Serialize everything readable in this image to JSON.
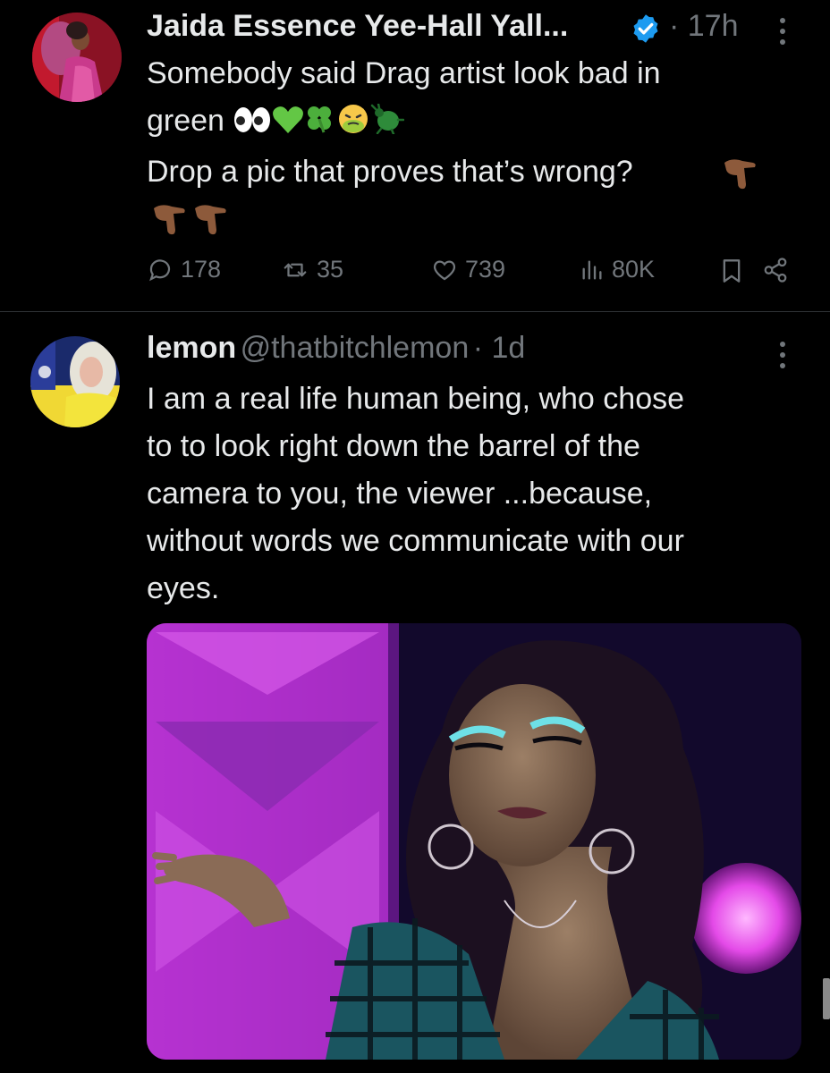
{
  "tweet1": {
    "display_name": "Jaida Essence Yee-Hall Yall...",
    "time": "· 17h",
    "text_line1": "Somebody said Drag artist look bad in",
    "text_line2_word": "green",
    "text_line3": "Drop a pic that proves that’s wrong?",
    "stats": {
      "replies": "178",
      "retweets": "35",
      "likes": "739",
      "views": "80K"
    }
  },
  "tweet2": {
    "display_name": "lemon",
    "handle": "@thatbitchlemon",
    "time": "· 1d",
    "text_lines": [
      "I am a real life human being, who chose",
      "to to look right down the barrel of the",
      "camera to you, the viewer ...because,",
      "without words we communicate with our",
      "eyes."
    ]
  },
  "colors": {
    "background": "#000000",
    "text_primary": "#e7e9ea",
    "text_secondary": "#71767b",
    "verified_blue": "#1d9bf0",
    "divider": "#2f3336"
  }
}
